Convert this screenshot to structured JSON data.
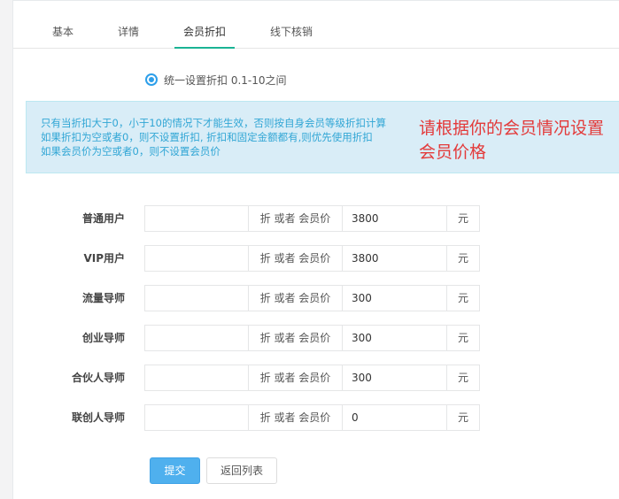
{
  "tabs": [
    {
      "label": "基本",
      "active": false
    },
    {
      "label": "详情",
      "active": false
    },
    {
      "label": "会员折扣",
      "active": true
    },
    {
      "label": "线下核销",
      "active": false
    }
  ],
  "discount_mode": {
    "label": "统一设置折扣 0.1-10之间",
    "checked": true
  },
  "info": {
    "lines": [
      "只有当折扣大于0，小于10的情况下才能生效，否则按自身会员等级折扣计算",
      "如果折扣为空或者0，则不设置折扣, 折扣和固定金额都有,则优先使用折扣",
      "如果会员价为空或者0，则不设置会员价"
    ],
    "note": "请根据你的会员情况设置会员价格"
  },
  "addon_label": "折 或者 会员价",
  "unit_label": "元",
  "members": [
    {
      "label": "普通用户",
      "discount": "",
      "price": "3800"
    },
    {
      "label": "VIP用户",
      "discount": "",
      "price": "3800"
    },
    {
      "label": "流量导师",
      "discount": "",
      "price": "300"
    },
    {
      "label": "创业导师",
      "discount": "",
      "price": "300"
    },
    {
      "label": "合伙人导师",
      "discount": "",
      "price": "300"
    },
    {
      "label": "联创人导师",
      "discount": "",
      "price": "0"
    }
  ],
  "buttons": {
    "submit": "提交",
    "back": "返回列表"
  },
  "colors": {
    "accent": "#1ab394",
    "primary": "#4fb0ee",
    "info_bg": "#d9edf7",
    "info_text": "#31a6d5",
    "note_text": "#e33a3a"
  }
}
